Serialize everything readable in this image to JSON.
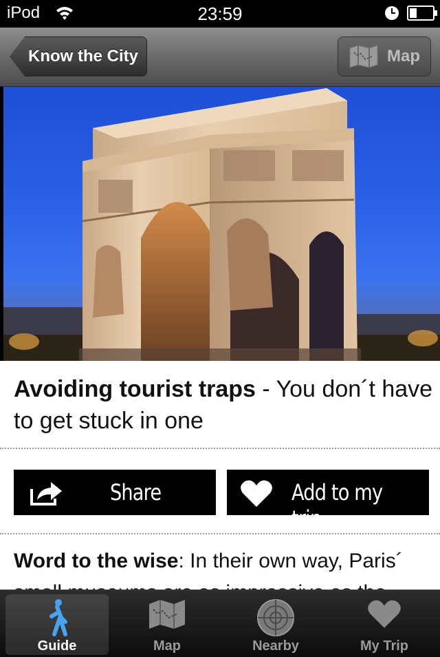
{
  "status_bar": {
    "carrier": "iPod",
    "time": "23:59"
  },
  "nav": {
    "back_label": "Know the City",
    "map_label": "Map"
  },
  "article": {
    "title_bold": "Avoiding tourist traps",
    "title_rest": " - You don´t have to get stuck in one",
    "share_label": "Share",
    "add_trip_label": "Add to my trip",
    "body_bold": "Word to the wise",
    "body_rest": ": In their own way, Paris´ small museums are as impressive as the"
  },
  "tabs": [
    {
      "label": "Guide",
      "icon": "walking-person-icon",
      "active": true
    },
    {
      "label": "Map",
      "icon": "map-icon",
      "active": false
    },
    {
      "label": "Nearby",
      "icon": "radar-icon",
      "active": false
    },
    {
      "label": "My Trip",
      "icon": "heart-icon",
      "active": false
    }
  ],
  "colors": {
    "accent_blue": "#3a8ee6",
    "sky": "#2a5fe6"
  }
}
